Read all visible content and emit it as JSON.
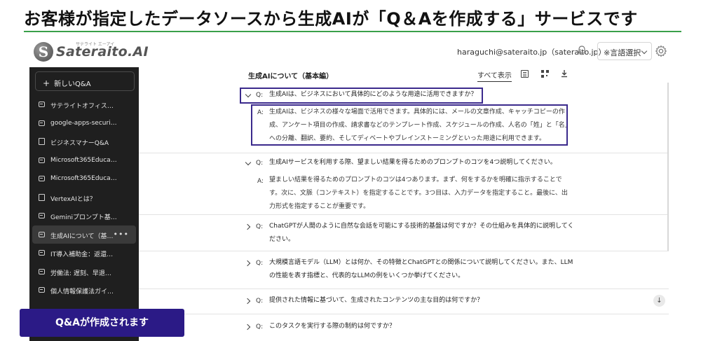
{
  "headline": "お客様が指定したデータソースから生成AIが「Q＆Aを作成する」サービスです",
  "logo": {
    "ruby": "サテライト エーアイ",
    "text": "Sateraito",
    "suffix": ".AI"
  },
  "topbar": {
    "account": "haraguchi@sateraito.jp（sateraito.jp）",
    "language_label": "※言語選択"
  },
  "sidebar": {
    "new_label": "新しいQ&A",
    "items": [
      {
        "label": "サテライトオフィス…",
        "icon": "chat-icon"
      },
      {
        "label": "google-apps-securi…",
        "icon": "chat-icon"
      },
      {
        "label": "ビジネスマナーQ&A",
        "icon": "document-icon"
      },
      {
        "label": "Microsoft365Educa…",
        "icon": "chat-icon"
      },
      {
        "label": "Microsoft365Educa…",
        "icon": "chat-icon"
      },
      {
        "label": "VertexAIとは？",
        "icon": "document-icon"
      },
      {
        "label": "Geminiプロンプト基…",
        "icon": "chat-icon"
      },
      {
        "label": "生成AIについて（基…",
        "icon": "chat-icon",
        "active": true
      },
      {
        "label": "IT導入補助金：返還…",
        "icon": "chat-icon"
      },
      {
        "label": "労働法: 遅刻、早退…",
        "icon": "chat-icon"
      },
      {
        "label": "個人情報保護法ガイ…",
        "icon": "chat-icon"
      }
    ]
  },
  "main": {
    "title": "生成AIについて（基本編）",
    "show_all": "すべて表示",
    "q_tag": "Q:",
    "a_tag": "A:",
    "qa": [
      {
        "question": "生成AIは、ビジネスにおいて具体的にどのような用途に活用できますか？",
        "answer_lines": [
          "生成AIは、ビジネスの様々な場面で活用できます。具体的には、メールの文章作成、キャッチコピーの作",
          "成、アンケート項目の作成、請求書などのテンプレート作成、スケジュールの作成、人名の「姓」と「名」",
          "への分離、翻訳、要約、そしてディベートやブレインストーミングといった用途に利用できます。"
        ],
        "expanded": true
      },
      {
        "question": "生成AIサービスを利用する際、望ましい結果を得るためのプロンプトのコツを4つ説明してください。",
        "answer_lines": [
          "望ましい結果を得るためのプロンプトのコツは4つあります。まず、何をするかを明確に指示することで",
          "す。次に、文脈（コンテキスト）を指定することです。3つ目は、入力データを指定すること。最後に、出",
          "力形式を指定することが重要です。"
        ],
        "expanded": true
      },
      {
        "question_lines": [
          "ChatGPTが人間のように自然な会話を可能にする技術的基盤は何ですか？その仕組みを具体的に説明してく",
          "ださい。"
        ],
        "expanded": false
      },
      {
        "question_lines": [
          "大規模言語モデル（LLM）とは何か、その特徴とChatGPTとの関係について説明してください。また、LLM",
          "の性能を表す指標と、代表的なLLMの例をいくつか挙げてください。"
        ],
        "expanded": false
      },
      {
        "question": "提供された情報に基づいて、生成されたコンテンツの主な目的は何ですか？",
        "expanded": false
      },
      {
        "question": "このタスクを実行する際の制約は何ですか？",
        "expanded": false
      }
    ]
  },
  "callout": "Q&Aが作成されます",
  "colors": {
    "accent_rule": "#3aa04a",
    "highlight": "#3b2a8c",
    "callout_bg": "#2b1a86",
    "sidebar_bg": "#1f1f1f"
  }
}
